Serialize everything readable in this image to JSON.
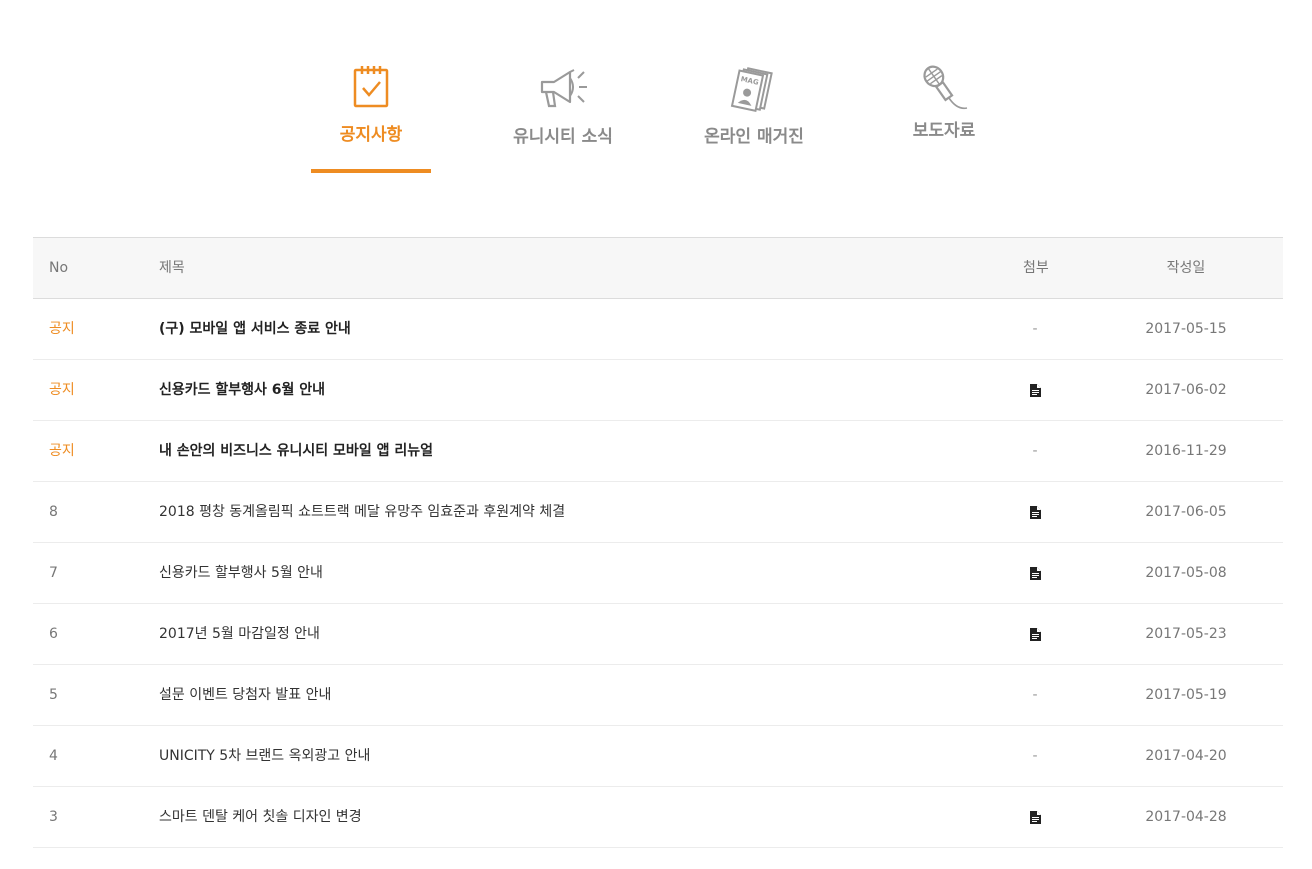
{
  "tabs": [
    {
      "label": "공지사항",
      "icon": "notepad-check-icon",
      "active": true
    },
    {
      "label": "유니시티 소식",
      "icon": "megaphone-icon",
      "active": false
    },
    {
      "label": "온라인 매거진",
      "icon": "magazine-icon",
      "active": false
    },
    {
      "label": "보도자료",
      "icon": "microphone-icon",
      "active": false
    }
  ],
  "magazine_icon_text": "MAG",
  "table": {
    "headers": {
      "no": "No",
      "title": "제목",
      "attachment": "첨부",
      "date": "작성일"
    },
    "rows": [
      {
        "no": "공지",
        "title": "(구) 모바일 앱 서비스 종료 안내",
        "attachment": "-",
        "date": "2017-05-15",
        "notice": true
      },
      {
        "no": "공지",
        "title": "신용카드 할부행사 6월 안내",
        "attachment": "file",
        "date": "2017-06-02",
        "notice": true
      },
      {
        "no": "공지",
        "title": "내 손안의 비즈니스 유니시티 모바일 앱 리뉴얼",
        "attachment": "-",
        "date": "2016-11-29",
        "notice": true
      },
      {
        "no": "8",
        "title": "2018 평창 동계올림픽 쇼트트랙 메달 유망주 임효준과 후원계약 체결",
        "attachment": "file",
        "date": "2017-06-05",
        "notice": false
      },
      {
        "no": "7",
        "title": "신용카드 할부행사 5월 안내",
        "attachment": "file",
        "date": "2017-05-08",
        "notice": false
      },
      {
        "no": "6",
        "title": "2017년 5월 마감일정 안내",
        "attachment": "file",
        "date": "2017-05-23",
        "notice": false
      },
      {
        "no": "5",
        "title": "설문 이벤트 당첨자 발표 안내",
        "attachment": "-",
        "date": "2017-05-19",
        "notice": false
      },
      {
        "no": "4",
        "title": "UNICITY 5차 브랜드 옥외광고 안내",
        "attachment": "-",
        "date": "2017-04-20",
        "notice": false
      },
      {
        "no": "3",
        "title": "스마트 덴탈 케어 칫솔 디자인 변경",
        "attachment": "file",
        "date": "2017-04-28",
        "notice": false
      }
    ]
  },
  "colors": {
    "accent": "#ee8c22",
    "inactive": "#8a8a8a"
  }
}
